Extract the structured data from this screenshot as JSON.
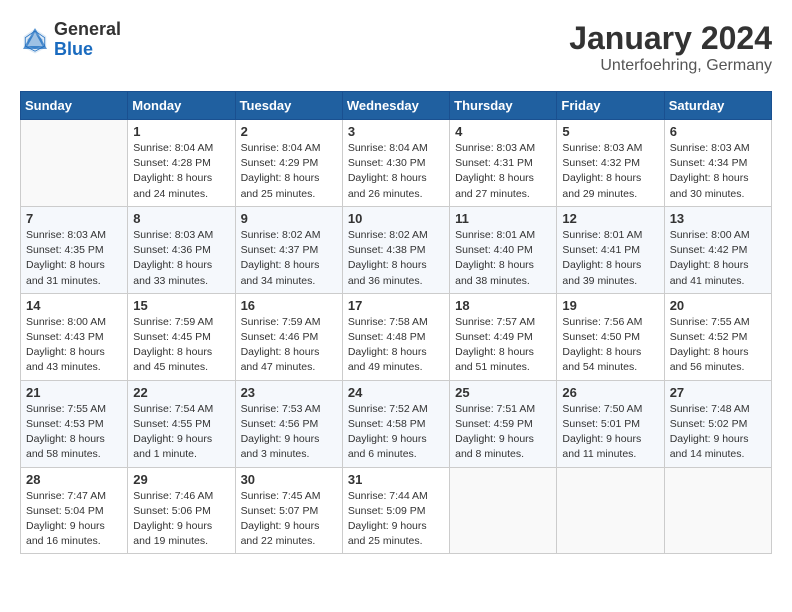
{
  "header": {
    "logo_general": "General",
    "logo_blue": "Blue",
    "title": "January 2024",
    "subtitle": "Unterfoehring, Germany"
  },
  "days_of_week": [
    "Sunday",
    "Monday",
    "Tuesday",
    "Wednesday",
    "Thursday",
    "Friday",
    "Saturday"
  ],
  "weeks": [
    [
      {
        "day": "",
        "sunrise": "",
        "sunset": "",
        "daylight": ""
      },
      {
        "day": "1",
        "sunrise": "Sunrise: 8:04 AM",
        "sunset": "Sunset: 4:28 PM",
        "daylight": "Daylight: 8 hours and 24 minutes."
      },
      {
        "day": "2",
        "sunrise": "Sunrise: 8:04 AM",
        "sunset": "Sunset: 4:29 PM",
        "daylight": "Daylight: 8 hours and 25 minutes."
      },
      {
        "day": "3",
        "sunrise": "Sunrise: 8:04 AM",
        "sunset": "Sunset: 4:30 PM",
        "daylight": "Daylight: 8 hours and 26 minutes."
      },
      {
        "day": "4",
        "sunrise": "Sunrise: 8:03 AM",
        "sunset": "Sunset: 4:31 PM",
        "daylight": "Daylight: 8 hours and 27 minutes."
      },
      {
        "day": "5",
        "sunrise": "Sunrise: 8:03 AM",
        "sunset": "Sunset: 4:32 PM",
        "daylight": "Daylight: 8 hours and 29 minutes."
      },
      {
        "day": "6",
        "sunrise": "Sunrise: 8:03 AM",
        "sunset": "Sunset: 4:34 PM",
        "daylight": "Daylight: 8 hours and 30 minutes."
      }
    ],
    [
      {
        "day": "7",
        "sunrise": "Sunrise: 8:03 AM",
        "sunset": "Sunset: 4:35 PM",
        "daylight": "Daylight: 8 hours and 31 minutes."
      },
      {
        "day": "8",
        "sunrise": "Sunrise: 8:03 AM",
        "sunset": "Sunset: 4:36 PM",
        "daylight": "Daylight: 8 hours and 33 minutes."
      },
      {
        "day": "9",
        "sunrise": "Sunrise: 8:02 AM",
        "sunset": "Sunset: 4:37 PM",
        "daylight": "Daylight: 8 hours and 34 minutes."
      },
      {
        "day": "10",
        "sunrise": "Sunrise: 8:02 AM",
        "sunset": "Sunset: 4:38 PM",
        "daylight": "Daylight: 8 hours and 36 minutes."
      },
      {
        "day": "11",
        "sunrise": "Sunrise: 8:01 AM",
        "sunset": "Sunset: 4:40 PM",
        "daylight": "Daylight: 8 hours and 38 minutes."
      },
      {
        "day": "12",
        "sunrise": "Sunrise: 8:01 AM",
        "sunset": "Sunset: 4:41 PM",
        "daylight": "Daylight: 8 hours and 39 minutes."
      },
      {
        "day": "13",
        "sunrise": "Sunrise: 8:00 AM",
        "sunset": "Sunset: 4:42 PM",
        "daylight": "Daylight: 8 hours and 41 minutes."
      }
    ],
    [
      {
        "day": "14",
        "sunrise": "Sunrise: 8:00 AM",
        "sunset": "Sunset: 4:43 PM",
        "daylight": "Daylight: 8 hours and 43 minutes."
      },
      {
        "day": "15",
        "sunrise": "Sunrise: 7:59 AM",
        "sunset": "Sunset: 4:45 PM",
        "daylight": "Daylight: 8 hours and 45 minutes."
      },
      {
        "day": "16",
        "sunrise": "Sunrise: 7:59 AM",
        "sunset": "Sunset: 4:46 PM",
        "daylight": "Daylight: 8 hours and 47 minutes."
      },
      {
        "day": "17",
        "sunrise": "Sunrise: 7:58 AM",
        "sunset": "Sunset: 4:48 PM",
        "daylight": "Daylight: 8 hours and 49 minutes."
      },
      {
        "day": "18",
        "sunrise": "Sunrise: 7:57 AM",
        "sunset": "Sunset: 4:49 PM",
        "daylight": "Daylight: 8 hours and 51 minutes."
      },
      {
        "day": "19",
        "sunrise": "Sunrise: 7:56 AM",
        "sunset": "Sunset: 4:50 PM",
        "daylight": "Daylight: 8 hours and 54 minutes."
      },
      {
        "day": "20",
        "sunrise": "Sunrise: 7:55 AM",
        "sunset": "Sunset: 4:52 PM",
        "daylight": "Daylight: 8 hours and 56 minutes."
      }
    ],
    [
      {
        "day": "21",
        "sunrise": "Sunrise: 7:55 AM",
        "sunset": "Sunset: 4:53 PM",
        "daylight": "Daylight: 8 hours and 58 minutes."
      },
      {
        "day": "22",
        "sunrise": "Sunrise: 7:54 AM",
        "sunset": "Sunset: 4:55 PM",
        "daylight": "Daylight: 9 hours and 1 minute."
      },
      {
        "day": "23",
        "sunrise": "Sunrise: 7:53 AM",
        "sunset": "Sunset: 4:56 PM",
        "daylight": "Daylight: 9 hours and 3 minutes."
      },
      {
        "day": "24",
        "sunrise": "Sunrise: 7:52 AM",
        "sunset": "Sunset: 4:58 PM",
        "daylight": "Daylight: 9 hours and 6 minutes."
      },
      {
        "day": "25",
        "sunrise": "Sunrise: 7:51 AM",
        "sunset": "Sunset: 4:59 PM",
        "daylight": "Daylight: 9 hours and 8 minutes."
      },
      {
        "day": "26",
        "sunrise": "Sunrise: 7:50 AM",
        "sunset": "Sunset: 5:01 PM",
        "daylight": "Daylight: 9 hours and 11 minutes."
      },
      {
        "day": "27",
        "sunrise": "Sunrise: 7:48 AM",
        "sunset": "Sunset: 5:02 PM",
        "daylight": "Daylight: 9 hours and 14 minutes."
      }
    ],
    [
      {
        "day": "28",
        "sunrise": "Sunrise: 7:47 AM",
        "sunset": "Sunset: 5:04 PM",
        "daylight": "Daylight: 9 hours and 16 minutes."
      },
      {
        "day": "29",
        "sunrise": "Sunrise: 7:46 AM",
        "sunset": "Sunset: 5:06 PM",
        "daylight": "Daylight: 9 hours and 19 minutes."
      },
      {
        "day": "30",
        "sunrise": "Sunrise: 7:45 AM",
        "sunset": "Sunset: 5:07 PM",
        "daylight": "Daylight: 9 hours and 22 minutes."
      },
      {
        "day": "31",
        "sunrise": "Sunrise: 7:44 AM",
        "sunset": "Sunset: 5:09 PM",
        "daylight": "Daylight: 9 hours and 25 minutes."
      },
      {
        "day": "",
        "sunrise": "",
        "sunset": "",
        "daylight": ""
      },
      {
        "day": "",
        "sunrise": "",
        "sunset": "",
        "daylight": ""
      },
      {
        "day": "",
        "sunrise": "",
        "sunset": "",
        "daylight": ""
      }
    ]
  ]
}
